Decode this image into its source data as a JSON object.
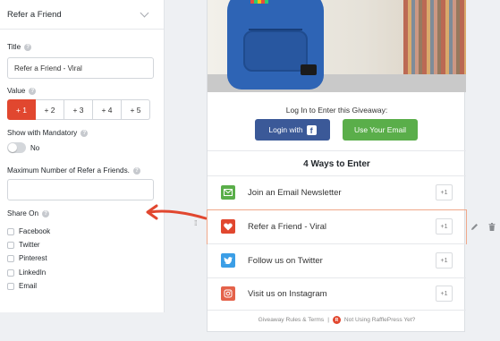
{
  "panel": {
    "title": "Refer a Friend",
    "title_field": {
      "label": "Title",
      "value": "Refer a Friend - Viral"
    },
    "value_field": {
      "label": "Value",
      "options": [
        "+ 1",
        "+ 2",
        "+ 3",
        "+ 4",
        "+ 5"
      ],
      "selected": "+ 1"
    },
    "mandatory": {
      "label": "Show with Mandatory",
      "state": "No"
    },
    "max_refer": {
      "label": "Maximum Number of Refer a Friends.",
      "value": ""
    },
    "share_on": {
      "label": "Share On",
      "options": [
        "Facebook",
        "Twitter",
        "Pinterest",
        "LinkedIn",
        "Email"
      ]
    },
    "help_glyph": "?"
  },
  "colors": {
    "accent": "#e1472f",
    "facebook": "#3b5998",
    "email_green": "#5aae4a",
    "twitter": "#3b9ee6",
    "instagram": "#e4624a",
    "highlight": "#f0a88a"
  },
  "giveaway": {
    "login_prompt": "Log In to Enter this Giveaway:",
    "login_facebook_label": "Login with",
    "facebook_glyph": "f",
    "email_button_label": "Use Your Email",
    "ways_title": "4 Ways to Enter",
    "entries": [
      {
        "label": "Join an Email Newsletter",
        "points": "+1",
        "icon": "email-icon"
      },
      {
        "label": "Refer a Friend - Viral",
        "points": "+1",
        "icon": "heart-icon"
      },
      {
        "label": "Follow us on Twitter",
        "points": "+1",
        "icon": "twitter-icon"
      },
      {
        "label": "Visit us on Instagram",
        "points": "+1",
        "icon": "instagram-icon"
      }
    ],
    "footer_rules": "Giveaway Rules & Terms",
    "footer_separator": "|",
    "footer_promo": "Not Using RafflePress Yet?"
  }
}
